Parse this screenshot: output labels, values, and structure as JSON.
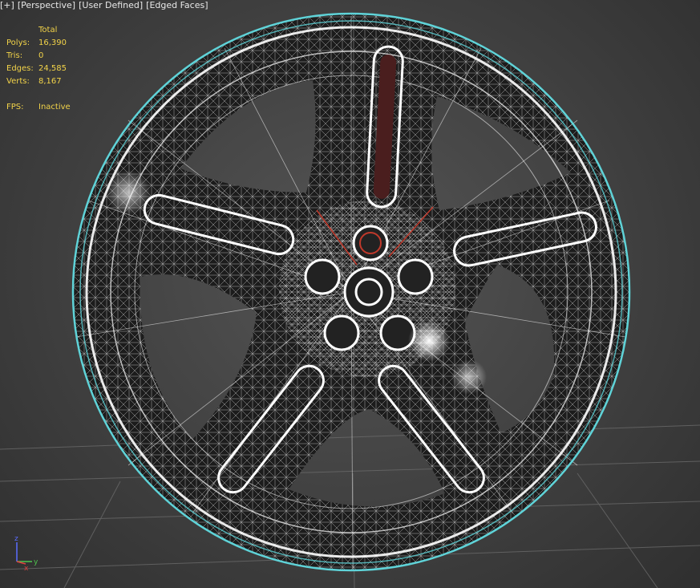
{
  "viewport_menu": {
    "plus": "[+]",
    "view": "[Perspective]",
    "shading": "[User Defined]",
    "edged": "[Edged Faces]"
  },
  "stats": {
    "header": "Total",
    "polys_label": "Polys:",
    "polys_value": "16,390",
    "tris_label": "Tris:",
    "tris_value": "0",
    "edges_label": "Edges:",
    "edges_value": "24,585",
    "verts_label": "Verts:",
    "verts_value": "8,167",
    "fps_label": "FPS:",
    "fps_value": "Inactive"
  },
  "axis": {
    "x": "x",
    "y": "y",
    "z": "z"
  },
  "colors": {
    "selection_outline": "#5fd3d8",
    "wire": "#ffffff",
    "stats_text": "#f2d349",
    "accent_red": "#c0392b"
  }
}
